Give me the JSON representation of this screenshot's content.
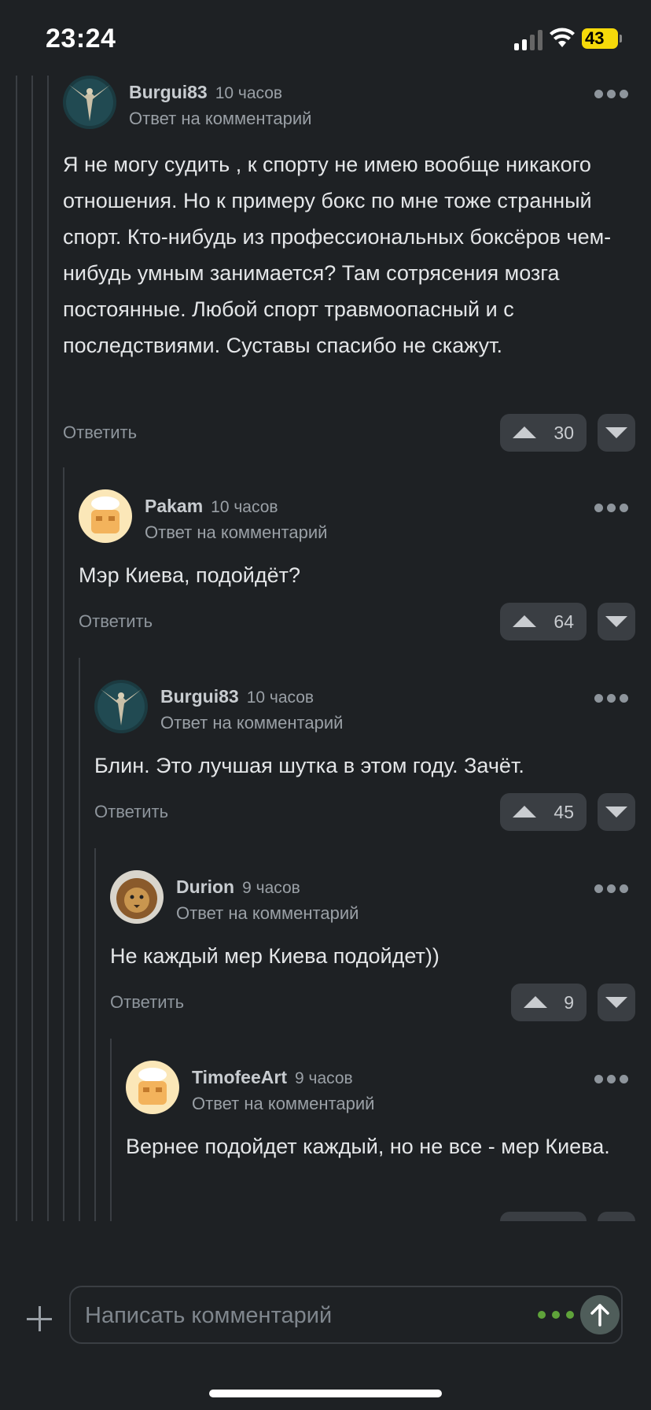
{
  "status": {
    "time": "23:24",
    "battery": "43"
  },
  "comments": [
    {
      "author": "Burgui83",
      "time": "10 часов",
      "reply_note": "Ответ на комментарий",
      "text": "Я не могу судить , к спорту не имею вообще никакого отношения. Но к примеру бокс по мне тоже странный спорт. Кто-нибудь из профессиональных боксёров чем-нибудь умным занимается? Там сотрясения мозга постоянные. Любой спорт травмоопасный и с последствиями. Суставы спасибо не скажут.",
      "reply_label": "Ответить",
      "votes": "30",
      "avatar": "angel-statue"
    },
    {
      "author": "Pakam",
      "time": "10 часов",
      "reply_note": "Ответ на комментарий",
      "text": "Мэр Киева, подойдёт?",
      "reply_label": "Ответить",
      "votes": "64",
      "avatar": "chef-toaster"
    },
    {
      "author": "Burgui83",
      "time": "10 часов",
      "reply_note": "Ответ на комментарий",
      "text": "Блин. Это лучшая шутка в этом году. Зачёт.",
      "reply_label": "Ответить",
      "votes": "45",
      "avatar": "angel-statue"
    },
    {
      "author": "Durion",
      "time": "9 часов",
      "reply_note": "Ответ на комментарий",
      "text": "Не каждый мер Киева подойдет))",
      "reply_label": "Ответить",
      "votes": "9",
      "avatar": "lion"
    },
    {
      "author": "TimofeeArt",
      "time": "9 часов",
      "reply_note": "Ответ на комментарий",
      "text": "Вернее подойдет каждый, но не все - мер Киева.",
      "avatar": "chef-toaster"
    }
  ],
  "composer": {
    "placeholder": "Написать комментарий"
  }
}
